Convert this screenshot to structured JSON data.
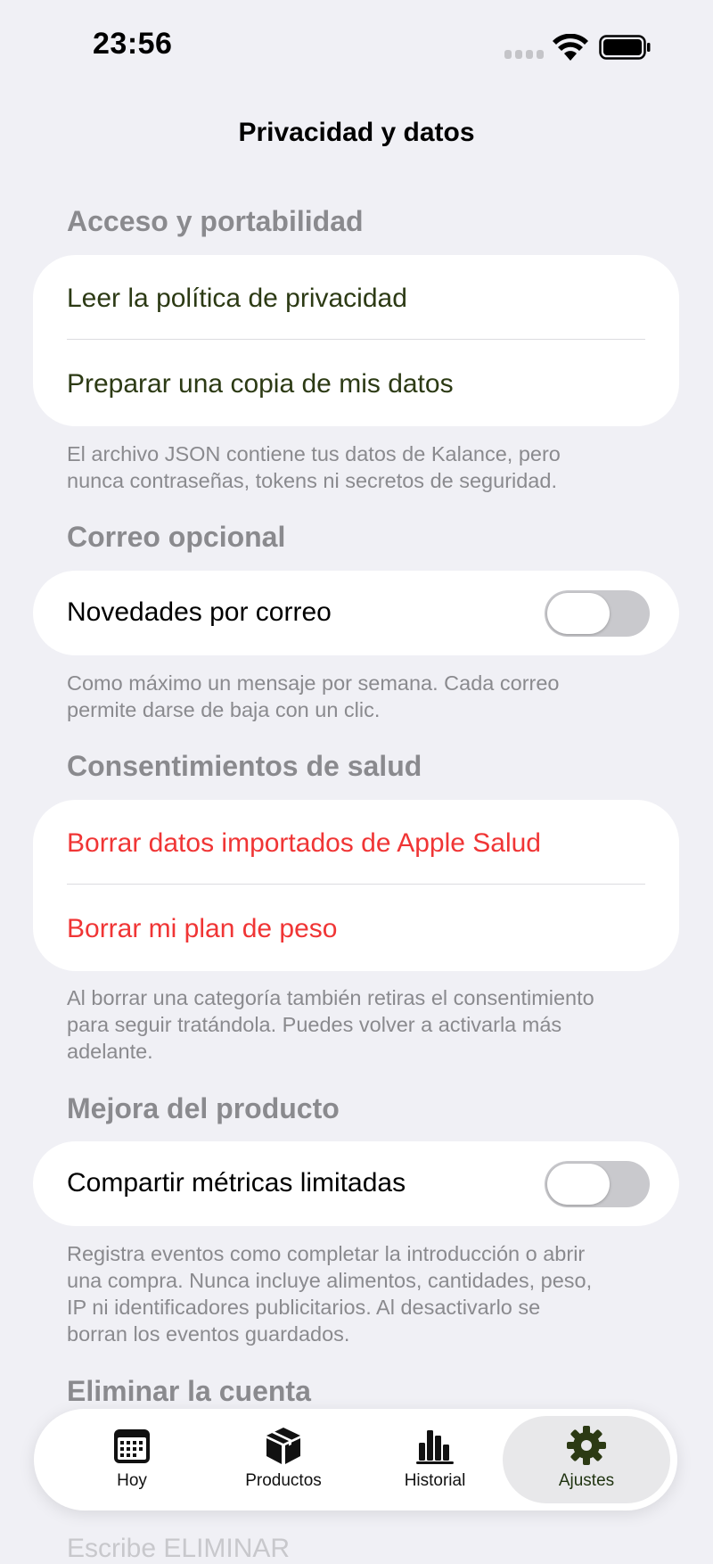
{
  "status_bar": {
    "time": "23:56"
  },
  "nav": {
    "title": "Privacidad y datos"
  },
  "sections": {
    "access": {
      "header": "Acceso y portabilidad",
      "items": [
        "Leer la política de privacidad",
        "Preparar una copia de mis datos"
      ],
      "footer_lines": [
        "El archivo JSON contiene tus datos de Kalance, pero",
        "nunca contraseñas, tokens ni secretos de seguridad."
      ]
    },
    "email": {
      "header": "Correo opcional",
      "toggle_label": "Novedades por correo",
      "toggle_on": false,
      "footer_lines": [
        "Como máximo un mensaje por semana. Cada correo",
        "permite darse de baja con un clic."
      ]
    },
    "health": {
      "header": "Consentimientos de salud",
      "items": [
        "Borrar datos importados de Apple Salud",
        "Borrar mi plan de peso"
      ],
      "footer_lines": [
        "Al borrar una categoría también retiras el consentimiento",
        "para seguir tratándola. Puedes volver a activarla más",
        "adelante."
      ]
    },
    "product": {
      "header": "Mejora del producto",
      "toggle_label": "Compartir métricas limitadas",
      "toggle_on": false,
      "footer_lines": [
        "Registra eventos como completar la introducción o abrir",
        "una compra. Nunca incluye alimentos, cantidades, peso,",
        "IP ni identificadores publicitarios. Al desactivarlo se",
        "borran los eventos guardados."
      ]
    },
    "delete": {
      "header": "Eliminar la cuenta",
      "partial_text": "Escribe ELIMINAR"
    }
  },
  "tabbar": {
    "tabs": [
      {
        "label": "Hoy",
        "icon": "calendar-icon"
      },
      {
        "label": "Productos",
        "icon": "box-icon"
      },
      {
        "label": "Historial",
        "icon": "bar-chart-icon"
      },
      {
        "label": "Ajustes",
        "icon": "gear-icon"
      }
    ],
    "active_tab": "Ajustes"
  },
  "colors": {
    "accent": "#2c3a14",
    "destructive": "#f03535",
    "background": "#f0f0f5",
    "secondary_text": "#8a8a8e"
  }
}
